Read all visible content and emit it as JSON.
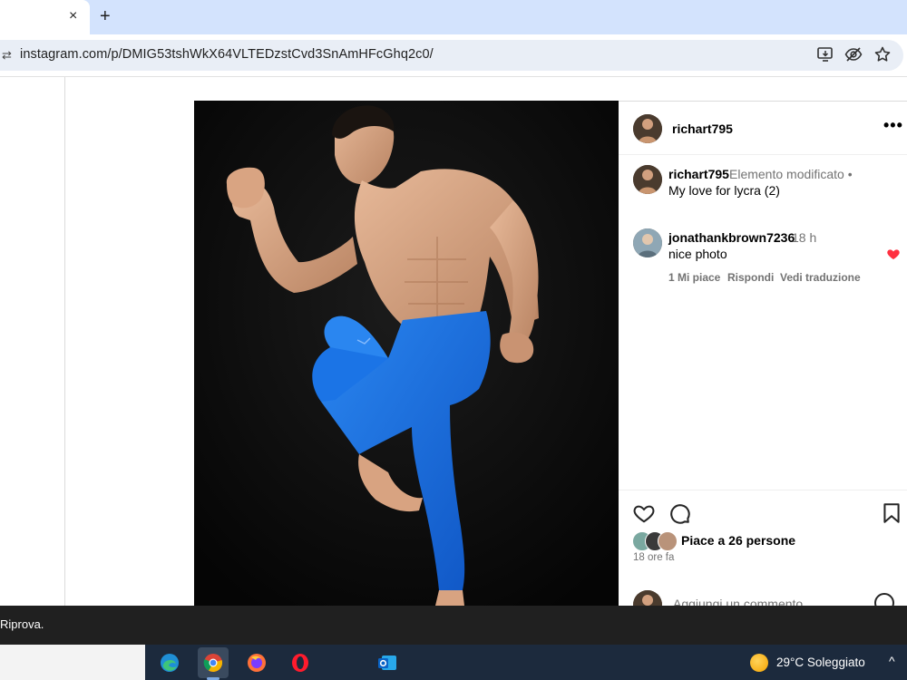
{
  "browser": {
    "tab_close": "×",
    "new_tab": "+",
    "url": "instagram.com/p/DMIG53tshWkX64VLTEDzstCvd3SnAmHFcGhq2c0/"
  },
  "post": {
    "author": "richart795",
    "more": "•••",
    "caption": {
      "username": "richart795",
      "meta": "Elemento modificato •",
      "text": "My love for lycra (2)"
    },
    "comments": [
      {
        "username": "jonathankbrown7236",
        "time": "18 h",
        "text": "nice photo",
        "likes": "1 Mi piace",
        "reply": "Rispondi",
        "translate": "Vedi traduzione"
      }
    ],
    "likes_text": "Piace a 26 persone",
    "time_ago": "18 ore fa",
    "add_comment_placeholder": "Aggiungi un commento..."
  },
  "notification": {
    "text": "Riprova."
  },
  "taskbar": {
    "weather": "29°C  Soleggiato",
    "tray_chevron": "^"
  },
  "colors": {
    "accent_blue": "#d3e3fd",
    "heart_red": "#ff3040",
    "leggings_blue": "#1a6fe0"
  }
}
